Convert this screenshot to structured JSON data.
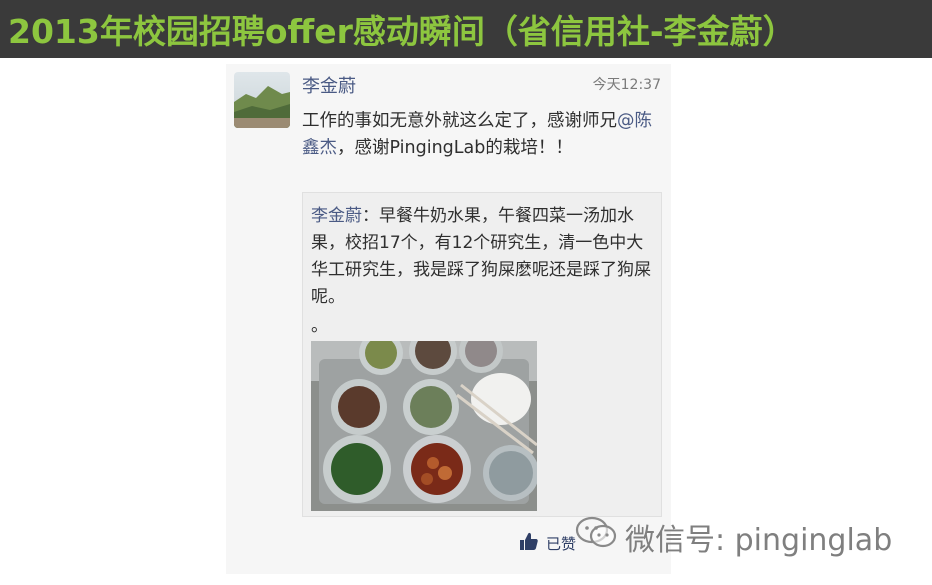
{
  "banner": {
    "title": "2013年校园招聘offer感动瞬间（省信用社-李金蔚）"
  },
  "post": {
    "author": "李金蔚",
    "time": "今天12:37",
    "text_before_mention": "工作的事如无意外就这么定了，感谢师兄",
    "mention": "@陈鑫杰",
    "text_after_mention": "，感谢PingingLab的栽培！！",
    "quote": {
      "author": "李金蔚",
      "text": "：早餐牛奶水果，午餐四菜一汤加水果，校招17个，有12个研究生，清一色中大华工研究生，我是踩了狗屎麽呢还是踩了狗屎呢。",
      "tail": "。"
    },
    "like_label": "已赞"
  },
  "watermark": {
    "text": "微信号: pinginglab"
  },
  "colors": {
    "banner_bg": "#3a3a3a",
    "banner_text": "#8dc63f",
    "link": "#4a5a84"
  }
}
